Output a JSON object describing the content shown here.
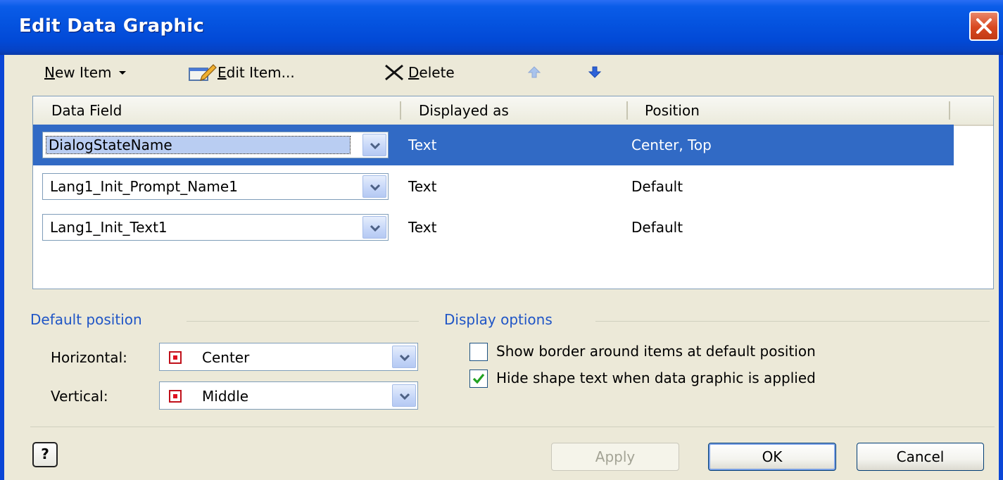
{
  "window": {
    "title": "Edit Data Graphic",
    "close_label": "close"
  },
  "toolbar": {
    "new_item": {
      "underlined": "N",
      "rest": "ew Item"
    },
    "edit_item": {
      "underlined": "E",
      "rest": "dit Item..."
    },
    "delete": {
      "underlined": "D",
      "rest": "elete"
    },
    "move_up_icon": "arrow-up-icon",
    "move_down_icon": "arrow-down-icon"
  },
  "grid": {
    "columns": [
      "Data Field",
      "Displayed as",
      "Position"
    ],
    "rows": [
      {
        "data_field": "DialogStateName",
        "displayed_as": "Text",
        "position": "Center, Top",
        "selected": true
      },
      {
        "data_field": "Lang1_Init_Prompt_Name1",
        "displayed_as": "Text",
        "position": "Default",
        "selected": false
      },
      {
        "data_field": "Lang1_Init_Text1",
        "displayed_as": "Text",
        "position": "Default",
        "selected": false
      }
    ]
  },
  "default_position": {
    "title": "Default position",
    "horizontal_label": "Horizontal:",
    "horizontal_value": "Center",
    "vertical_label": "Vertical:",
    "vertical_value": "Middle"
  },
  "display_options": {
    "title": "Display options",
    "show_border_label": "Show border around items at default position",
    "show_border_checked": false,
    "hide_text_label": "Hide shape text when data graphic is applied",
    "hide_text_checked": true
  },
  "buttons": {
    "help": "?",
    "apply": "Apply",
    "ok": "OK",
    "cancel": "Cancel"
  },
  "colors": {
    "titlebar": "#0554e0",
    "selection": "#316AC5",
    "group_title": "#1f55c6",
    "dialog_bg": "#ECE9D8"
  }
}
